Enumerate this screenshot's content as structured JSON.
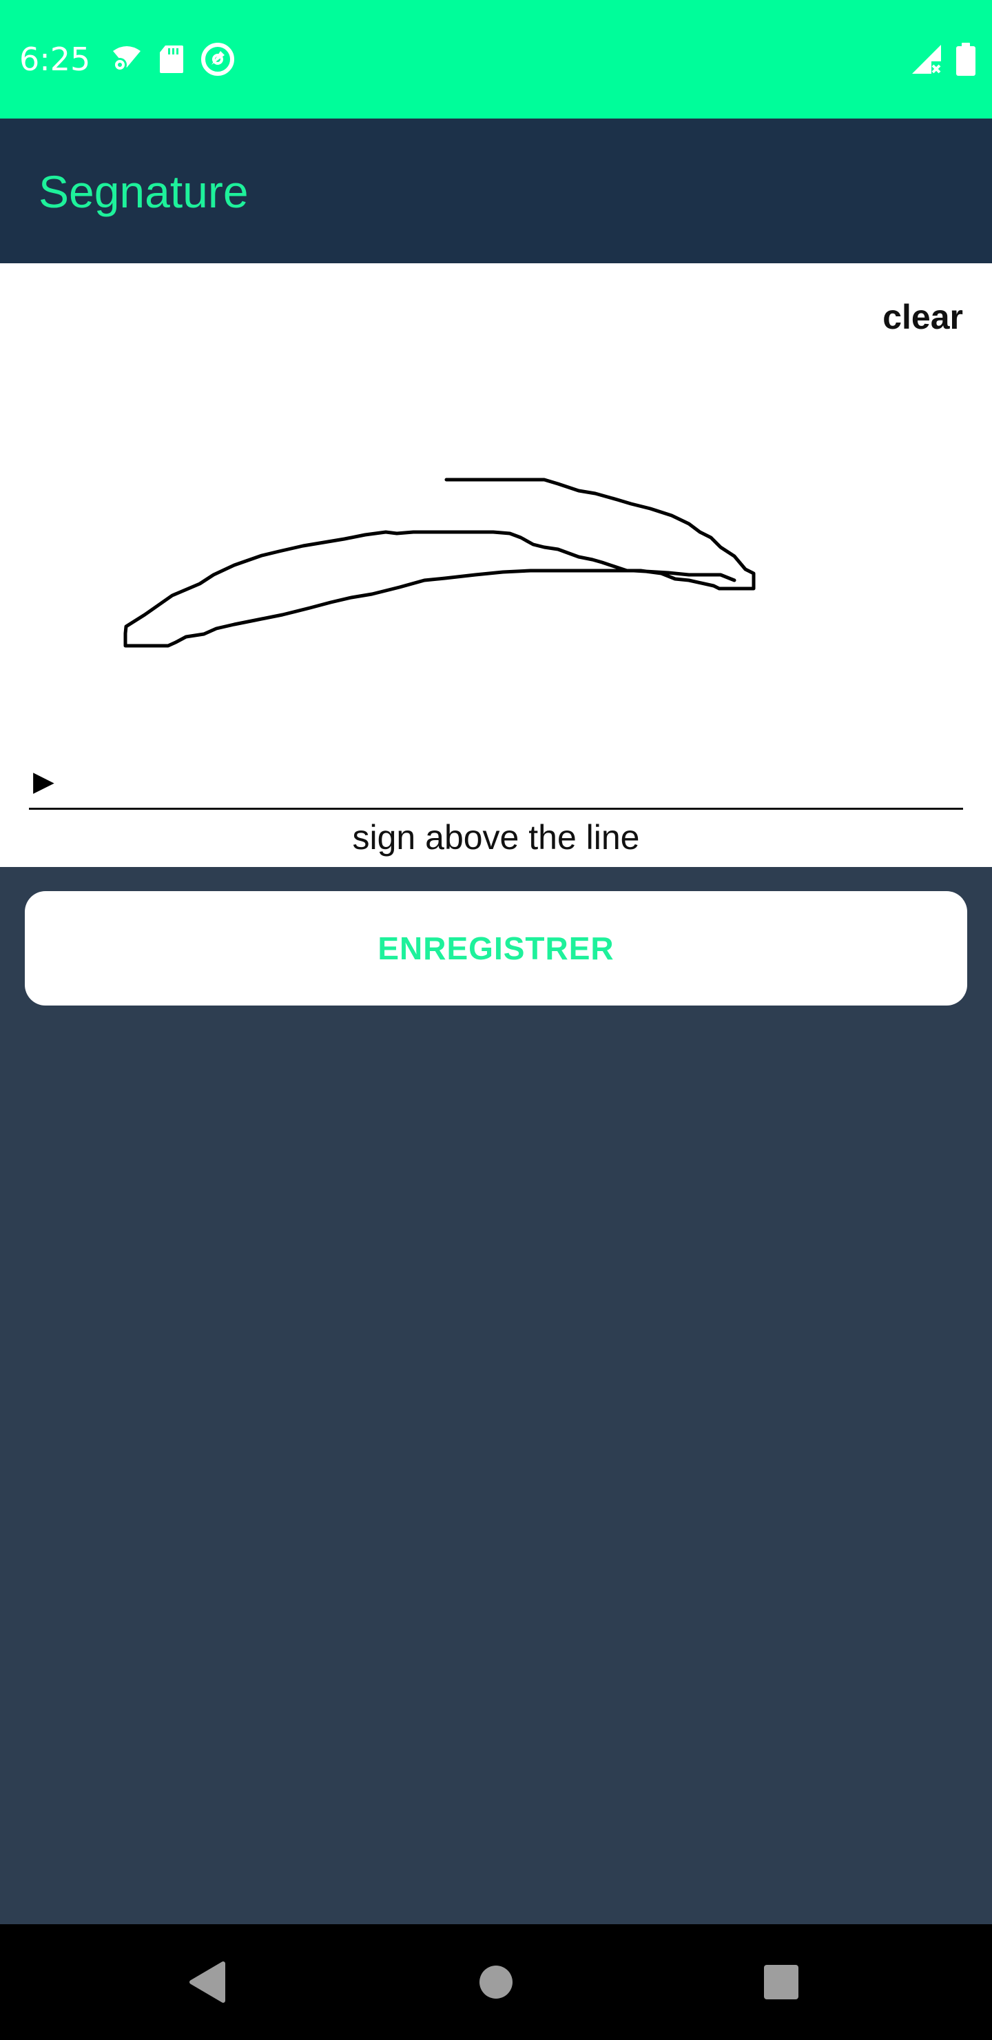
{
  "status_bar": {
    "time": "6:25",
    "icons_left": [
      "wifi-gear-icon",
      "sd-card-icon",
      "sync-icon"
    ],
    "icons_right": [
      "signal-no-data-icon",
      "battery-icon"
    ],
    "background": "#00fd9a"
  },
  "app_bar": {
    "title": "Segnature",
    "background": "#1c3149",
    "title_color": "#1ef19b"
  },
  "signature_pad": {
    "clear_label": "clear",
    "marker_glyph": "▶",
    "caption": "sign above the line",
    "has_signature": true
  },
  "actions": {
    "save_label": "ENREGISTRER",
    "save_color": "#1ef19b"
  },
  "nav_bar": {
    "buttons": [
      "back-icon",
      "home-icon",
      "recents-icon"
    ]
  },
  "colors": {
    "page_background": "#2e3e51"
  }
}
